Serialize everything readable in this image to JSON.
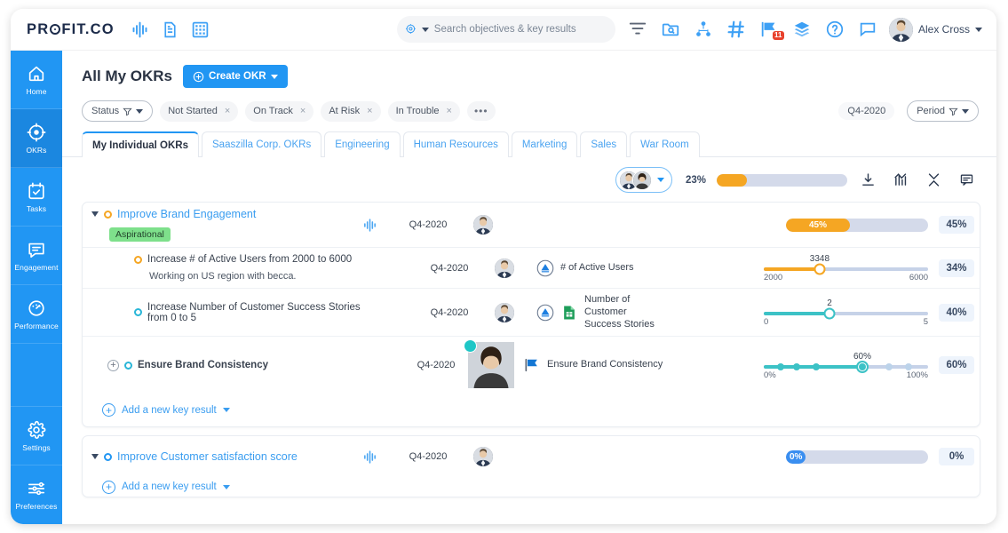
{
  "brand": {
    "name_light": "PR",
    "name_o": "O",
    "name_rest": "FIT.CO"
  },
  "topbar": {
    "icons": [
      {
        "name": "align-icon",
        "label": "Align"
      },
      {
        "name": "document-icon",
        "label": "Documents"
      },
      {
        "name": "grid-icon",
        "label": "Grid"
      }
    ],
    "search": {
      "placeholder": "Search objectives & key results",
      "value": ""
    },
    "right_icons": [
      {
        "name": "filter-icon",
        "label": "Filter"
      },
      {
        "name": "folder-search-icon",
        "label": "Browse"
      },
      {
        "name": "org-tree-icon",
        "label": "Org Chart"
      },
      {
        "name": "hash-icon",
        "label": "Tags"
      },
      {
        "name": "flag-icon",
        "label": "Flags",
        "badge": "11"
      },
      {
        "name": "layers-icon",
        "label": "Layers"
      },
      {
        "name": "help-icon",
        "label": "Help"
      },
      {
        "name": "chat-icon",
        "label": "Chat"
      }
    ],
    "user": {
      "name": "Alex Cross"
    }
  },
  "sidebar": {
    "items": [
      {
        "icon": "home-icon",
        "label": "Home",
        "active": false
      },
      {
        "icon": "target-icon",
        "label": "OKRs",
        "active": true
      },
      {
        "icon": "calendar-check-icon",
        "label": "Tasks",
        "active": false
      },
      {
        "icon": "speech-bubble-icon",
        "label": "Engagement",
        "active": false
      },
      {
        "icon": "gauge-icon",
        "label": "Performance",
        "active": false
      }
    ],
    "bottom_items": [
      {
        "icon": "gear-icon",
        "label": "Settings"
      },
      {
        "icon": "sliders-icon",
        "label": "Preferences"
      }
    ]
  },
  "page": {
    "title": "All My OKRs",
    "create_button": "Create OKR"
  },
  "filters": {
    "status_label": "Status",
    "chips": [
      "Not Started",
      "On Track",
      "At Risk",
      "In Trouble"
    ],
    "more": "•••",
    "period_value": "Q4-2020",
    "period_label": "Period"
  },
  "tabs": [
    {
      "label": "My Individual OKRs",
      "active": true
    },
    {
      "label": "Saaszilla Corp. OKRs",
      "active": false
    },
    {
      "label": "Engineering",
      "active": false
    },
    {
      "label": "Human Resources",
      "active": false
    },
    {
      "label": "Marketing",
      "active": false
    },
    {
      "label": "Sales",
      "active": false
    },
    {
      "label": "War Room",
      "active": false
    }
  ],
  "toolbar": {
    "overall_percent": "23%",
    "overall_value": 23,
    "buttons": [
      {
        "name": "download-icon",
        "label": "Export"
      },
      {
        "name": "chart-icon",
        "label": "Analytics"
      },
      {
        "name": "collapse-icon",
        "label": "Collapse All"
      },
      {
        "name": "comment-icon",
        "label": "Comments"
      }
    ]
  },
  "objectives": [
    {
      "title": "Improve Brand Engagement",
      "tag": "Aspirational",
      "period": "Q4-2020",
      "progress_label": "45%",
      "progress_value": 45,
      "pct_badge": "45%",
      "key_results": [
        {
          "title": "Increase # of Active Users from 2000 to 6000",
          "note": "Working on US region with becca.",
          "period": "Q4-2020",
          "metric_name": "# of Active Users",
          "type": "numeric",
          "current": "3348",
          "min": "2000",
          "max": "6000",
          "fill_percent": 34,
          "pct_badge": "34%",
          "color": "#f5a623",
          "has_doc_icon": false
        },
        {
          "title": "Increase Number of Customer Success Stories from 0 to 5",
          "note": "",
          "period": "Q4-2020",
          "metric_name": "Number of Customer Success Stories",
          "type": "numeric",
          "current": "2",
          "min": "0",
          "max": "5",
          "fill_percent": 40,
          "pct_badge": "40%",
          "color": "#3cc2c6",
          "has_doc_icon": true
        },
        {
          "title": "Ensure Brand Consistency",
          "note": "",
          "period": "Q4-2020",
          "metric_name": "Ensure Brand Consistency",
          "type": "milestone",
          "current": "60%",
          "min": "0%",
          "max": "100%",
          "fill_percent": 60,
          "pct_badge": "60%",
          "color": "#3cc2c6",
          "has_doc_icon": false,
          "milestones": [
            10,
            20,
            32,
            60,
            76,
            88
          ]
        }
      ],
      "add_kr_label": "Add a new key result"
    },
    {
      "title": "Improve Customer satisfaction score",
      "tag": "",
      "period": "Q4-2020",
      "progress_label": "0%",
      "progress_value": 0,
      "pct_badge": "0%",
      "key_results": [],
      "add_kr_label": "Add a new key result"
    }
  ],
  "colors": {
    "brand_blue": "#2196f3",
    "accent_orange": "#f5a623",
    "accent_teal": "#3cc2c6",
    "tag_green": "#7ee08b",
    "badge_red": "#e8412c",
    "track_grey": "#d4daea"
  }
}
